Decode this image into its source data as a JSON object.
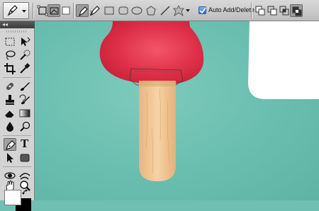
{
  "options_bar": {
    "auto_add_delete_label": "Auto Add/Delete",
    "auto_add_delete_checked": true
  },
  "toolbox": {
    "type_tool_glyph": "T",
    "collapse_glyph": "◂◂"
  },
  "colors": {
    "canvas_bg": "#6fc0b2",
    "popsicle_red": "#e0324a",
    "stick_wood": "#f2c996",
    "background_white": "#ffffff"
  }
}
